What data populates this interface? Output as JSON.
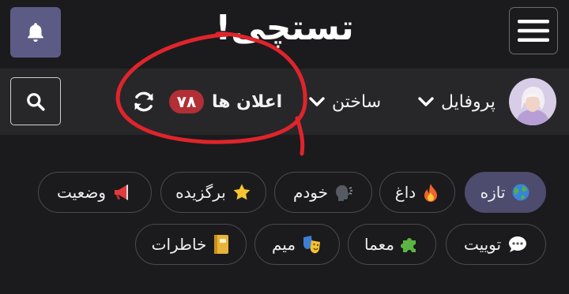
{
  "header": {
    "logo_text": "تستچی!",
    "bell_icon": "bell-icon",
    "menu_icon": "hamburger-menu-icon"
  },
  "nav": {
    "search_icon": "search-icon",
    "refresh_icon": "refresh-icon",
    "notifications_label": "اعلان ها",
    "notifications_count": "۷۸",
    "create_label": "ساختن",
    "profile_label": "پروفایل",
    "avatar": "user-avatar"
  },
  "chips": [
    {
      "label": "تازه",
      "icon": "globe-icon",
      "active": true
    },
    {
      "label": "داغ",
      "icon": "fire-icon",
      "active": false
    },
    {
      "label": "خودم",
      "icon": "speaking-head-icon",
      "active": false
    },
    {
      "label": "برگزیده",
      "icon": "star-icon",
      "active": false
    },
    {
      "label": "وضعیت",
      "icon": "megaphone-icon",
      "active": false
    },
    {
      "label": "توییت",
      "icon": "speech-bubble-icon",
      "active": false
    },
    {
      "label": "معما",
      "icon": "puzzle-icon",
      "active": false
    },
    {
      "label": "میم",
      "icon": "theater-masks-icon",
      "active": false
    },
    {
      "label": "خاطرات",
      "icon": "notebook-icon",
      "active": false
    }
  ],
  "colors": {
    "background": "#1b1b1d",
    "navbar": "#27272a",
    "bell_button": "#5b5b85",
    "badge": "#b12f35",
    "active_chip": "#4d4c6e",
    "annotation": "#e0242b"
  }
}
